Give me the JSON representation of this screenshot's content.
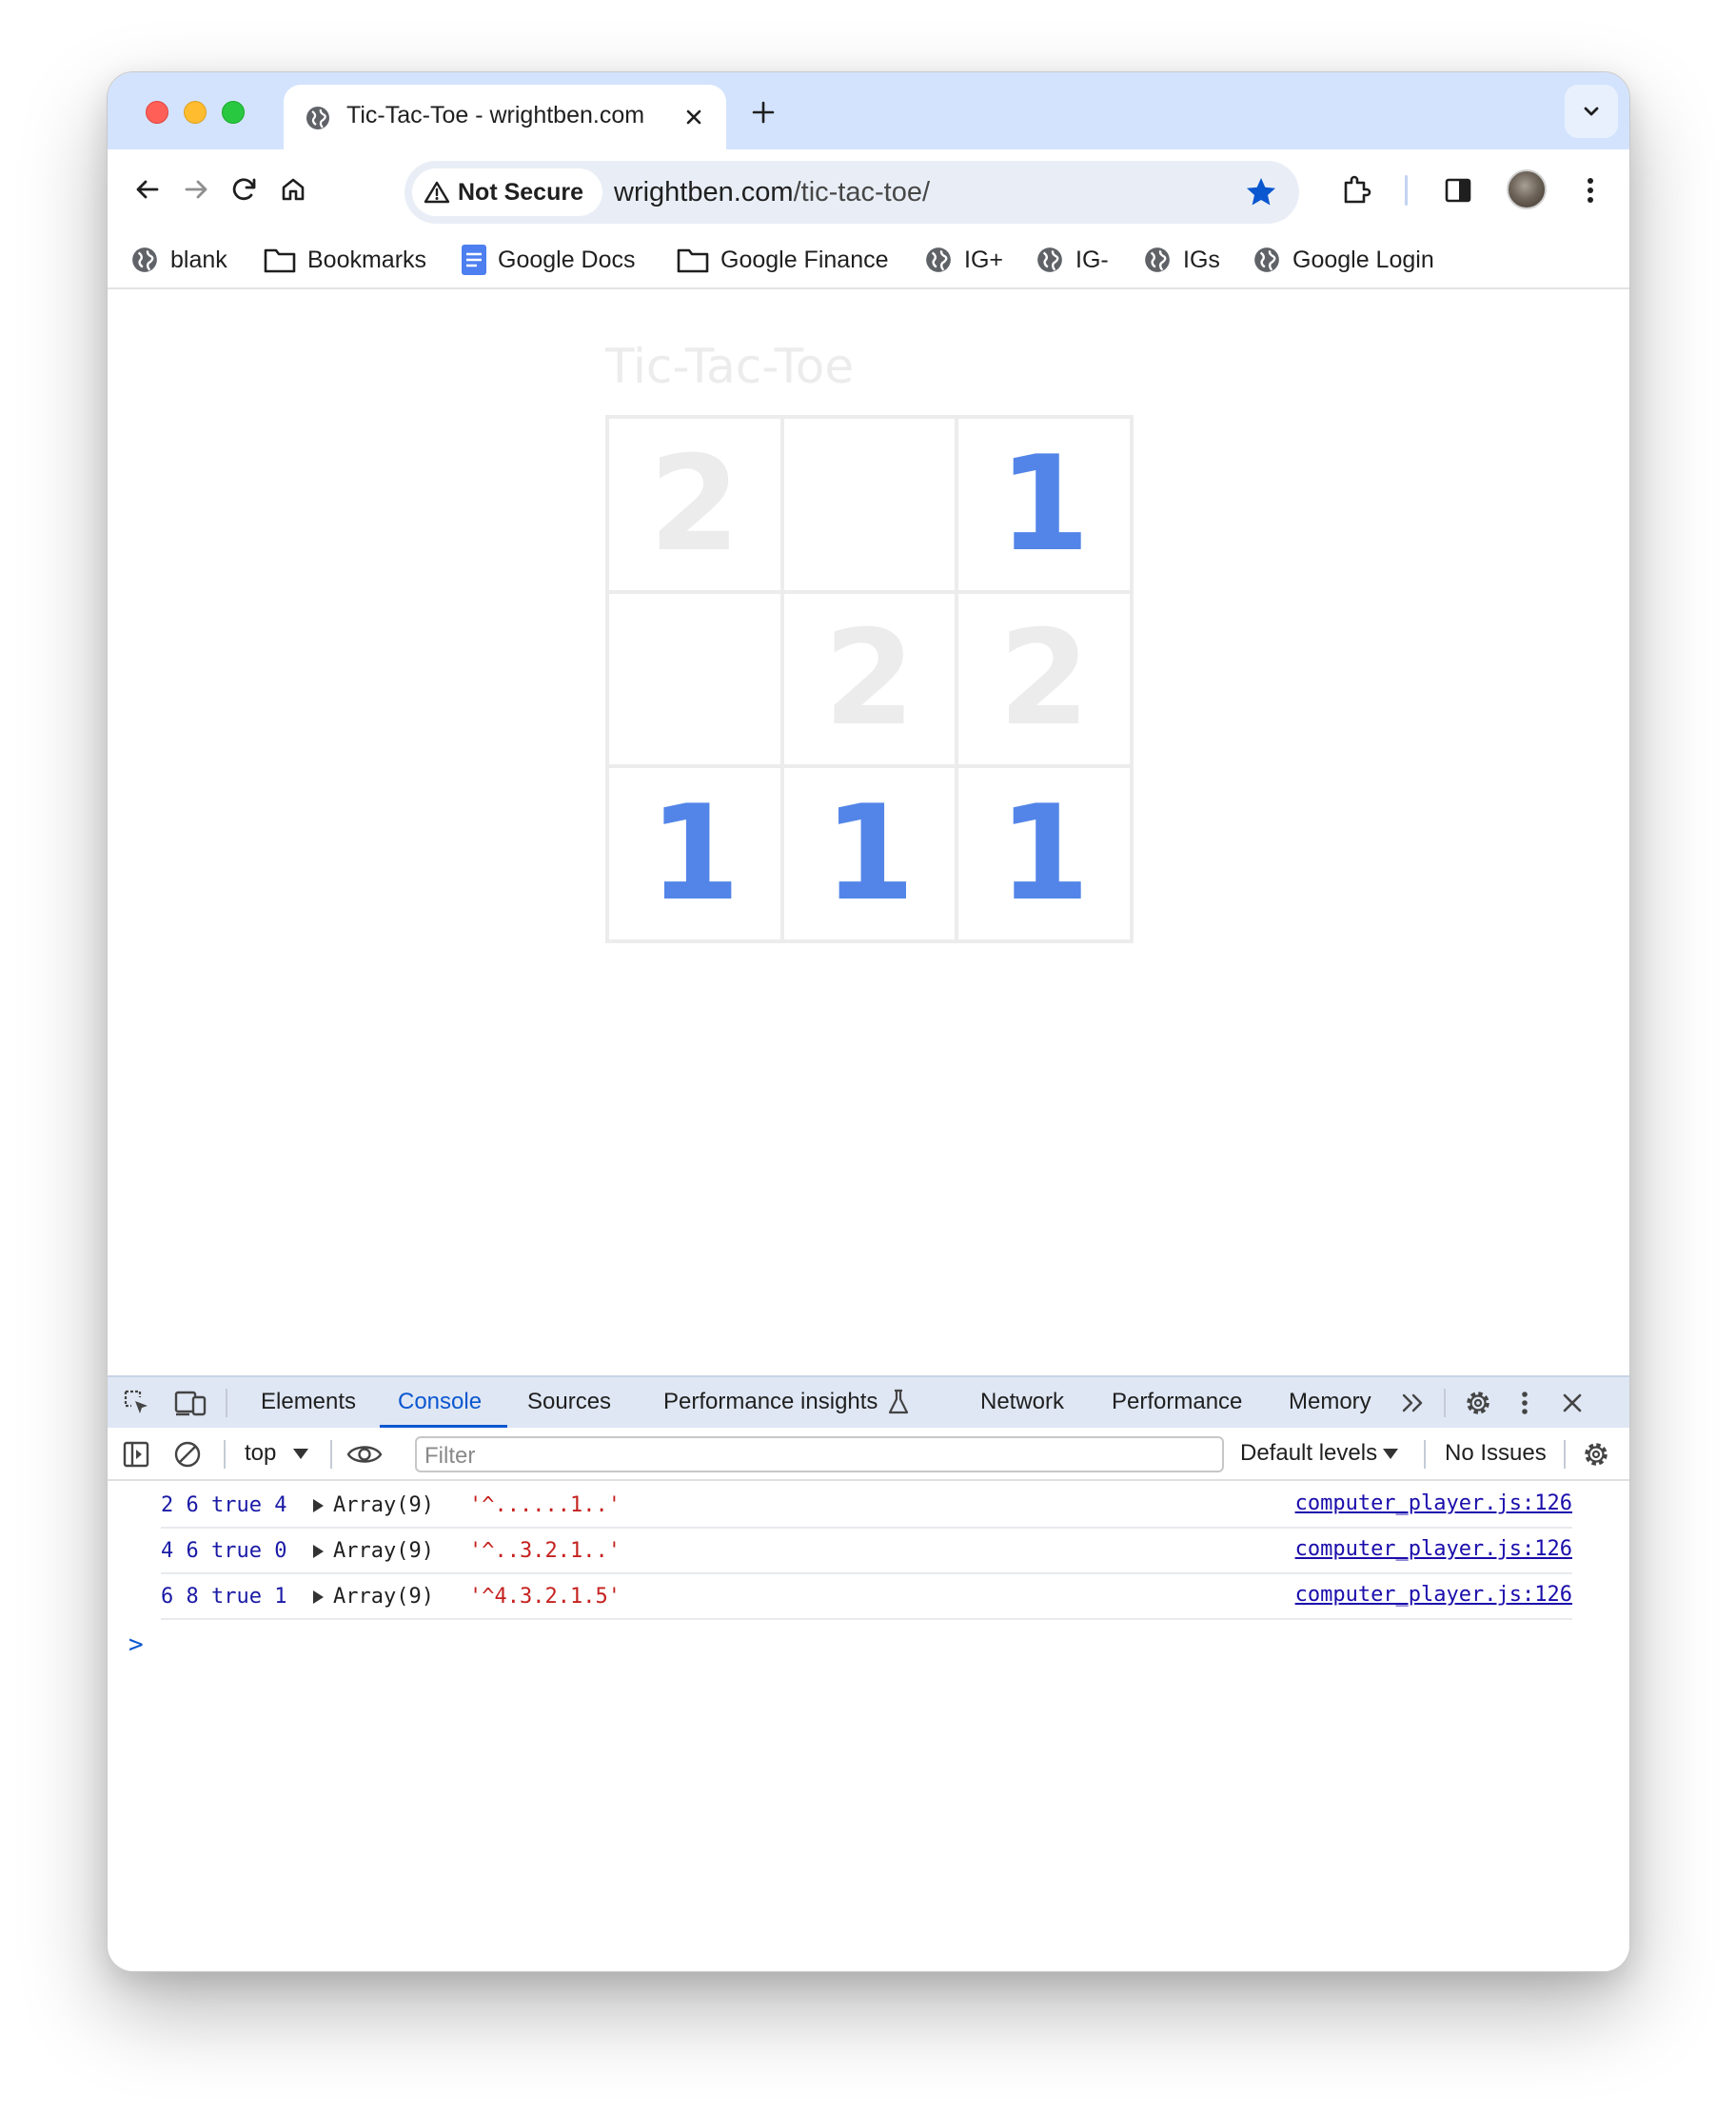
{
  "tab": {
    "title": "Tic-Tac-Toe - wrightben.com",
    "icon": "globe-icon"
  },
  "omnibox": {
    "security_label": "Not Secure",
    "url_host": "wrightben.com",
    "url_path": "/tic-tac-toe/"
  },
  "bookmarks": [
    {
      "label": "blank",
      "icon": "globe-icon"
    },
    {
      "label": "Bookmarks",
      "icon": "folder-icon"
    },
    {
      "label": "Google Docs",
      "icon": "docs-icon"
    },
    {
      "label": "Google Finance",
      "icon": "folder-icon"
    },
    {
      "label": "IG+",
      "icon": "globe-icon"
    },
    {
      "label": "IG-",
      "icon": "globe-icon"
    },
    {
      "label": "IGs",
      "icon": "globe-icon"
    },
    {
      "label": "Google Login",
      "icon": "globe-icon"
    }
  ],
  "page": {
    "title": "Tic-Tac-Toe",
    "board": [
      "2",
      "",
      "1",
      "",
      "2",
      "2",
      "1",
      "1",
      "1"
    ]
  },
  "devtools": {
    "tabs": [
      "Elements",
      "Console",
      "Sources",
      "Performance insights",
      "Network",
      "Performance",
      "Memory"
    ],
    "active_tab": "Console",
    "context": "top",
    "filter_placeholder": "Filter",
    "levels": "Default levels",
    "issues": "No Issues",
    "logs": [
      {
        "args": "2 6 true 4",
        "array": "Array(9)",
        "str": "'^......1..'",
        "source": "computer_player.js:126"
      },
      {
        "args": "4 6 true 0",
        "array": "Array(9)",
        "str": "'^..3.2.1..'",
        "source": "computer_player.js:126"
      },
      {
        "args": "6 8 true 1",
        "array": "Array(9)",
        "str": "'^4.3.2.1.5'",
        "source": "computer_player.js:126"
      }
    ],
    "prompt": ">"
  },
  "colors": {
    "player1": "#5385e8",
    "player2": "#ececec",
    "accent": "#0b57d0",
    "tabstrip": "#d3e3fd"
  }
}
